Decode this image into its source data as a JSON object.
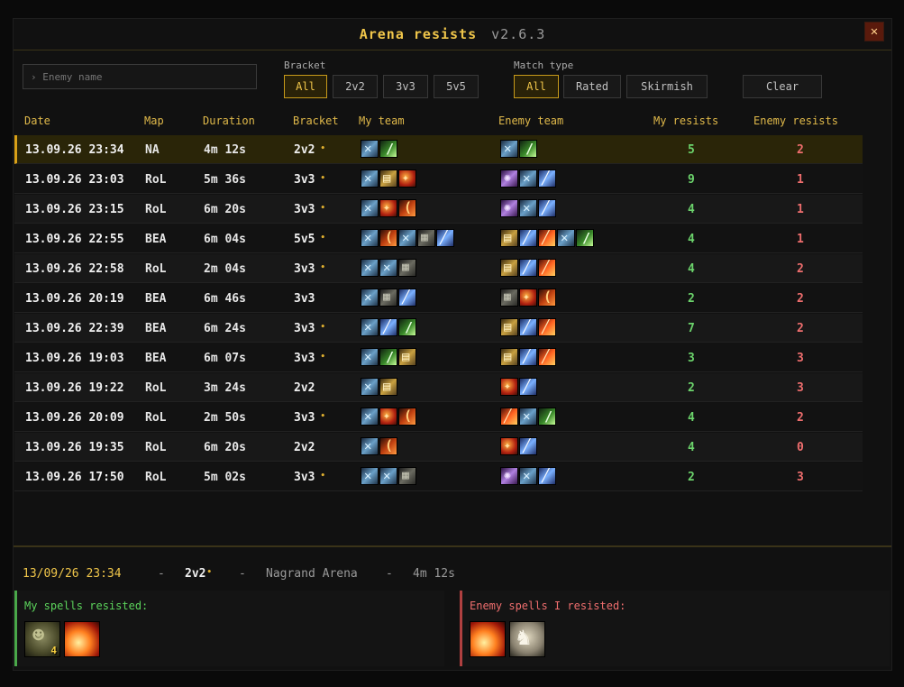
{
  "window": {
    "title": "Arena resists",
    "version": "v2.6.3",
    "close_glyph": "✕"
  },
  "search": {
    "placeholder": "› Enemy name",
    "value": ""
  },
  "bracket": {
    "label": "Bracket",
    "options": [
      "All",
      "2v2",
      "3v3",
      "5v5"
    ],
    "selected": "All"
  },
  "match_type": {
    "label": "Match type",
    "options": [
      "All",
      "Rated",
      "Skirmish"
    ],
    "selected": "All"
  },
  "clear_label": "Clear",
  "table": {
    "headers": {
      "date": "Date",
      "map": "Map",
      "duration": "Duration",
      "bracket": "Bracket",
      "my_team": "My team",
      "enemy_team": "Enemy team",
      "my_resists": "My resists",
      "enemy_resists": "Enemy resists"
    },
    "rated_marker": "•",
    "rows": [
      {
        "date": "13.09.26  23:34",
        "map": "NA",
        "duration": "4m 12s",
        "bracket": "2v2",
        "rated": true,
        "my_team": [
          "a",
          "b"
        ],
        "enemy_team": [
          "a",
          "b"
        ],
        "my_resists": "5",
        "enemy_resists": "2",
        "selected": true
      },
      {
        "date": "13.09.26  23:03",
        "map": "RoL",
        "duration": "5m 36s",
        "bracket": "3v3",
        "rated": true,
        "my_team": [
          "a",
          "c",
          "d"
        ],
        "enemy_team": [
          "h",
          "a",
          "g"
        ],
        "my_resists": "9",
        "enemy_resists": "1"
      },
      {
        "date": "13.09.26  23:15",
        "map": "RoL",
        "duration": "6m 20s",
        "bracket": "3v3",
        "rated": true,
        "my_team": [
          "a",
          "d",
          "e"
        ],
        "enemy_team": [
          "h",
          "a",
          "g"
        ],
        "my_resists": "4",
        "enemy_resists": "1"
      },
      {
        "date": "13.09.26  22:55",
        "map": "BEA",
        "duration": "6m 04s",
        "bracket": "5v5",
        "rated": true,
        "my_team": [
          "a",
          "e",
          "a",
          "f",
          "g"
        ],
        "enemy_team": [
          "c",
          "g",
          "i",
          "a",
          "b"
        ],
        "my_resists": "4",
        "enemy_resists": "1"
      },
      {
        "date": "13.09.26  22:58",
        "map": "RoL",
        "duration": "2m 04s",
        "bracket": "3v3",
        "rated": true,
        "my_team": [
          "a",
          "a",
          "f"
        ],
        "enemy_team": [
          "c",
          "g",
          "i"
        ],
        "my_resists": "4",
        "enemy_resists": "2"
      },
      {
        "date": "13.09.26  20:19",
        "map": "BEA",
        "duration": "6m 46s",
        "bracket": "3v3",
        "rated": false,
        "my_team": [
          "a",
          "f",
          "g"
        ],
        "enemy_team": [
          "f",
          "d",
          "e"
        ],
        "my_resists": "2",
        "enemy_resists": "2"
      },
      {
        "date": "13.09.26  22:39",
        "map": "BEA",
        "duration": "6m 24s",
        "bracket": "3v3",
        "rated": true,
        "my_team": [
          "a",
          "g",
          "b"
        ],
        "enemy_team": [
          "c",
          "g",
          "i"
        ],
        "my_resists": "7",
        "enemy_resists": "2"
      },
      {
        "date": "13.09.26  19:03",
        "map": "BEA",
        "duration": "6m 07s",
        "bracket": "3v3",
        "rated": true,
        "my_team": [
          "a",
          "b",
          "c"
        ],
        "enemy_team": [
          "c",
          "g",
          "i"
        ],
        "my_resists": "3",
        "enemy_resists": "3"
      },
      {
        "date": "13.09.26  19:22",
        "map": "RoL",
        "duration": "3m 24s",
        "bracket": "2v2",
        "rated": false,
        "my_team": [
          "a",
          "c"
        ],
        "enemy_team": [
          "d",
          "g"
        ],
        "my_resists": "2",
        "enemy_resists": "3"
      },
      {
        "date": "13.09.26  20:09",
        "map": "RoL",
        "duration": "2m 50s",
        "bracket": "3v3",
        "rated": true,
        "my_team": [
          "a",
          "d",
          "e"
        ],
        "enemy_team": [
          "i",
          "a",
          "b"
        ],
        "my_resists": "4",
        "enemy_resists": "2"
      },
      {
        "date": "13.09.26  19:35",
        "map": "RoL",
        "duration": "6m 20s",
        "bracket": "2v2",
        "rated": false,
        "my_team": [
          "a",
          "e"
        ],
        "enemy_team": [
          "d",
          "g"
        ],
        "my_resists": "4",
        "enemy_resists": "0"
      },
      {
        "date": "13.09.26  17:50",
        "map": "RoL",
        "duration": "5m 02s",
        "bracket": "3v3",
        "rated": true,
        "my_team": [
          "a",
          "a",
          "f"
        ],
        "enemy_team": [
          "h",
          "a",
          "g"
        ],
        "my_resists": "2",
        "enemy_resists": "3"
      }
    ]
  },
  "detail": {
    "date": "13/09/26 23:34",
    "sep": "-",
    "bracket": "2v2",
    "rated_marker": "•",
    "map_name": "Nagrand Arena",
    "duration": "4m 12s",
    "my_spells_title": "My spells resisted:",
    "enemy_spells_title": "Enemy spells I resisted:",
    "my_spells": [
      {
        "icon": "orc-warrior-icon",
        "count": "4"
      },
      {
        "icon": "fire-spell-icon",
        "count": ""
      }
    ],
    "enemy_spells": [
      {
        "icon": "fire-spell-icon",
        "count": ""
      },
      {
        "icon": "horse-icon",
        "count": ""
      }
    ]
  },
  "colors": {
    "accent": "#f0c64a",
    "green": "#6cd46c",
    "red": "#ef6e6e"
  }
}
